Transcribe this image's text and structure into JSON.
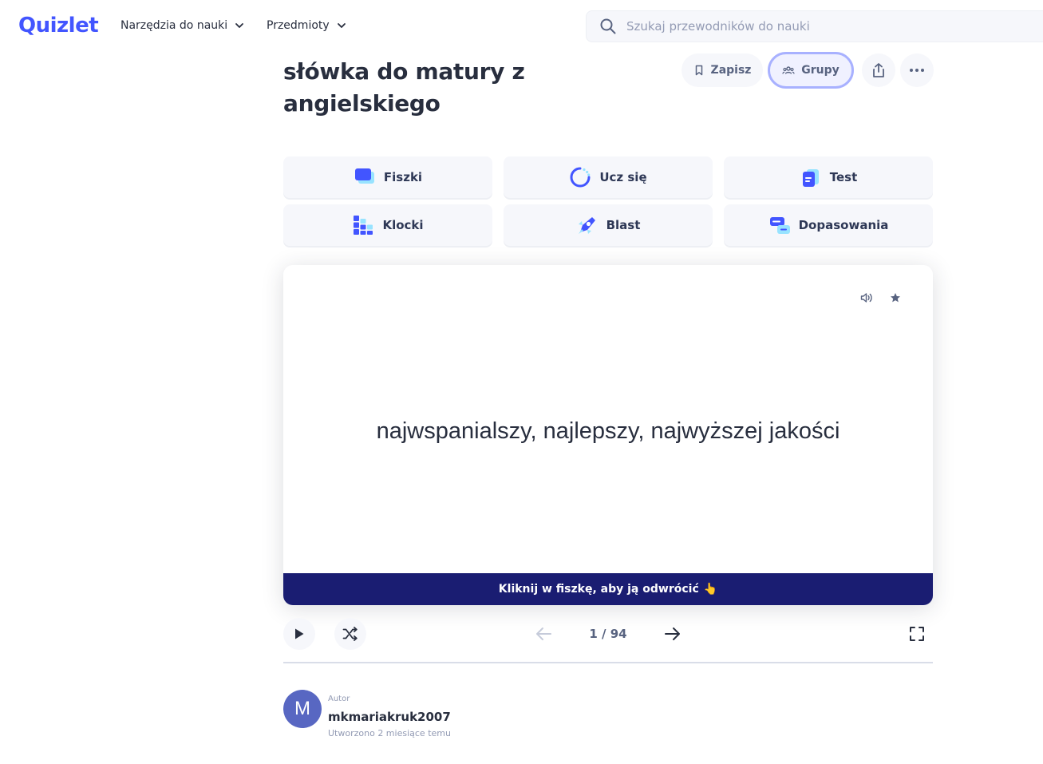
{
  "header": {
    "logo": "Quizlet",
    "nav": [
      {
        "label": "Narzędzia do nauki",
        "icon": "chevron-down-icon"
      },
      {
        "label": "Przedmioty",
        "icon": "chevron-down-icon"
      }
    ],
    "search": {
      "placeholder": "Szukaj przewodników do nauki",
      "value": ""
    }
  },
  "set": {
    "title": "słówka do matury z angielskiego",
    "actions": {
      "save_label": "Zapisz",
      "groups_label": "Grupy"
    }
  },
  "modes": [
    {
      "label": "Fiszki",
      "icon": "flashcards-icon"
    },
    {
      "label": "Ucz się",
      "icon": "learn-icon"
    },
    {
      "label": "Test",
      "icon": "test-icon"
    },
    {
      "label": "Klocki",
      "icon": "blocks-icon"
    },
    {
      "label": "Blast",
      "icon": "blast-icon"
    },
    {
      "label": "Dopasowania",
      "icon": "match-icon"
    }
  ],
  "card": {
    "term": "najwspanialszy, najlepszy, najwyższej jakości",
    "hint": "Kliknij w fiszkę, aby ją odwrócić",
    "hint_emoji": "👆"
  },
  "controls": {
    "counter": "1 / 94"
  },
  "author": {
    "label": "Autor",
    "initial": "M",
    "name": "mkmariakruk2007",
    "created": "Utworzono 2 miesiące temu"
  },
  "colors": {
    "brand": "#4255ff",
    "hint_bar": "#1a1d72",
    "avatar": "#5867c2",
    "groups_border": "#a8b1ff"
  }
}
